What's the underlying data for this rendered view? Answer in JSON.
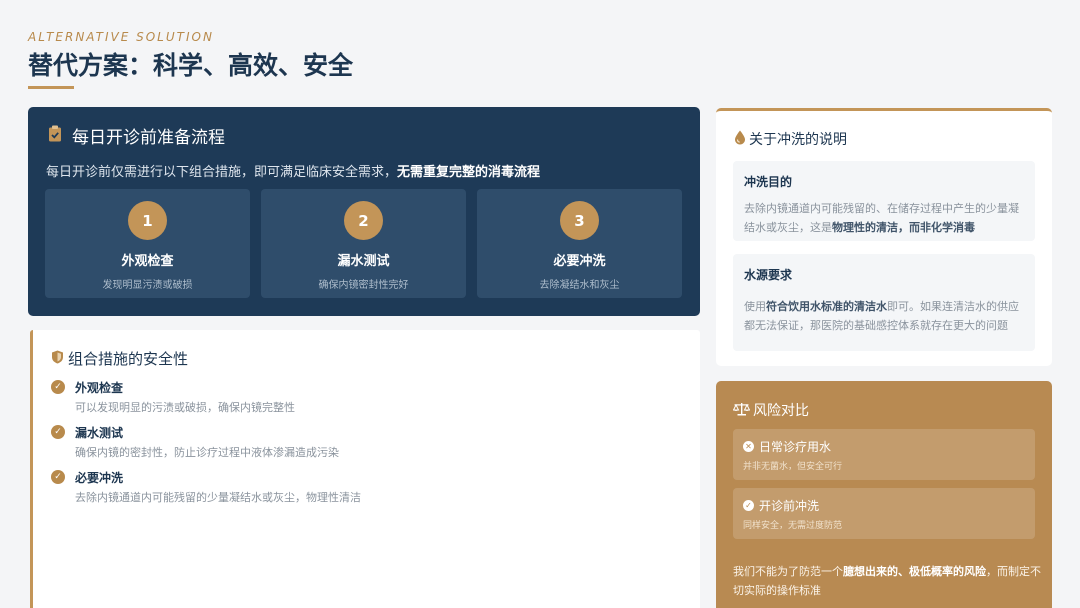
{
  "header": {
    "eyebrow": "ALTERNATIVE SOLUTION",
    "title": "替代方案：科学、高效、安全"
  },
  "process": {
    "icon": "clipboard-check-icon",
    "title": "每日开诊前准备流程",
    "desc_prefix": "每日开诊前仅需进行以下组合措施，即可满足临床安全需求，",
    "desc_bold": "无需重复完整的消毒流程",
    "steps": [
      {
        "num": "1",
        "name": "外观检查",
        "sub": "发现明显污渍或破损"
      },
      {
        "num": "2",
        "name": "漏水测试",
        "sub": "确保内镜密封性完好"
      },
      {
        "num": "3",
        "name": "必要冲洗",
        "sub": "去除凝结水和灰尘"
      }
    ]
  },
  "safety": {
    "icon": "shield-icon",
    "title": "组合措施的安全性",
    "items": [
      {
        "title": "外观检查",
        "desc": "可以发现明显的污渍或破损，确保内镜完整性"
      },
      {
        "title": "漏水测试",
        "desc": "确保内镜的密封性，防止诊疗过程中液体渗漏造成污染"
      },
      {
        "title": "必要冲洗",
        "desc": "去除内镜通道内可能残留的少量凝结水或灰尘，物理性清洁"
      }
    ]
  },
  "rinse": {
    "icon": "water-drop-icon",
    "title": "关于冲洗的说明",
    "purpose": {
      "title": "冲洗目的",
      "desc_prefix": "去除内镜通道内可能残留的、在储存过程中产生的少量凝结水或灰尘，这是",
      "desc_bold": "物理性的清洁，而非化学消毒"
    },
    "water": {
      "title": "水源要求",
      "desc_prefix": "使用",
      "desc_bold": "符合饮用水标准的清洁水",
      "desc_suffix": "即可。如果连清洁水的供应都无法保证，那医院的基础感控体系就存在更大的问题"
    }
  },
  "risk": {
    "icon": "scale-icon",
    "title": "风险对比",
    "items": [
      {
        "mark": "✕",
        "title": "日常诊疗用水",
        "desc": "并非无菌水，但安全可行"
      },
      {
        "mark": "✓",
        "title": "开诊前冲洗",
        "desc": "同样安全，无需过度防范"
      }
    ],
    "note_prefix": "我们不能为了防范一个",
    "note_bold": "臆想出来的、极低概率的风险",
    "note_suffix": "，而制定不切实际的操作标准"
  },
  "colors": {
    "navy": "#1e3a57",
    "gold": "#c39558",
    "step_bg": "#2f4d6b",
    "risk_bg": "#b88a52"
  }
}
